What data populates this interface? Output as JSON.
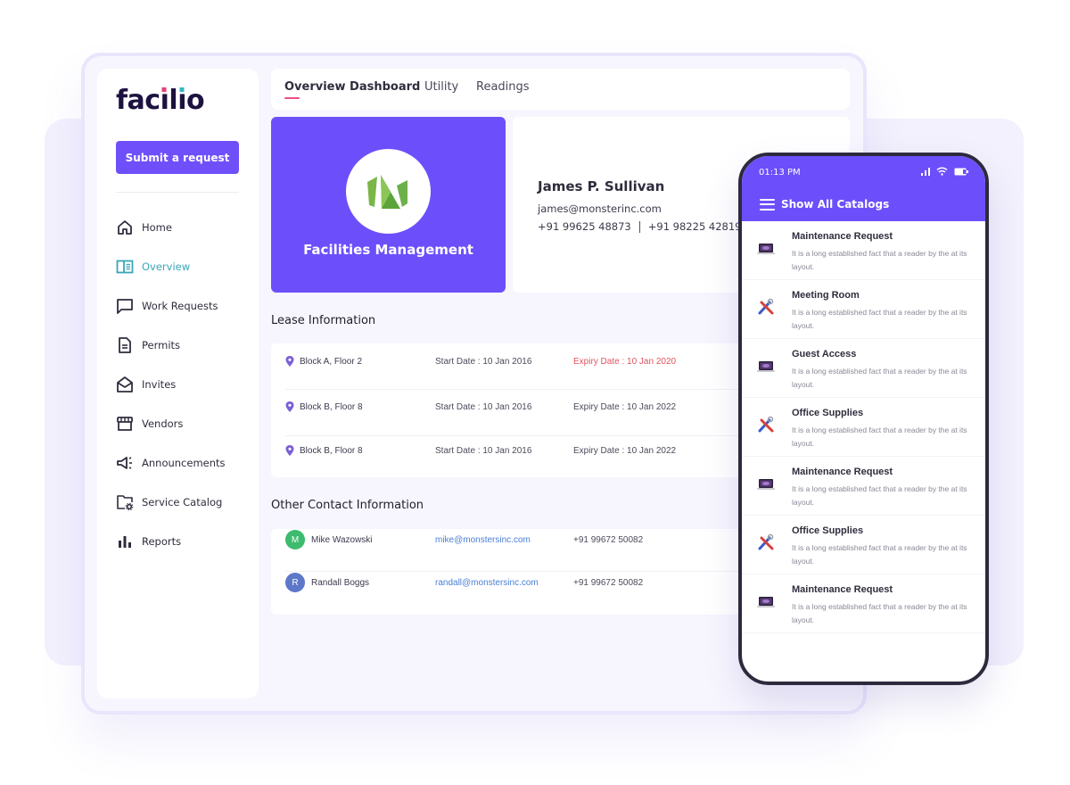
{
  "app": {
    "logo_text": "facilio",
    "submit_button": "Submit a request"
  },
  "sidebar": {
    "items": [
      {
        "label": "Home",
        "icon": "home-icon",
        "active": false
      },
      {
        "label": "Overview",
        "icon": "overview-icon",
        "active": true
      },
      {
        "label": "Work Requests",
        "icon": "chat-icon",
        "active": false
      },
      {
        "label": "Permits",
        "icon": "document-icon",
        "active": false
      },
      {
        "label": "Invites",
        "icon": "envelope-open-icon",
        "active": false
      },
      {
        "label": "Vendors",
        "icon": "store-icon",
        "active": false
      },
      {
        "label": "Announcements",
        "icon": "megaphone-icon",
        "active": false
      },
      {
        "label": "Service Catalog",
        "icon": "folder-settings-icon",
        "active": false
      },
      {
        "label": "Reports",
        "icon": "bar-chart-icon",
        "active": false
      }
    ]
  },
  "tabs": [
    {
      "label": "Overview Dashboard",
      "active": true
    },
    {
      "label": "Utility",
      "active": false
    },
    {
      "label": "Readings",
      "active": false
    }
  ],
  "facility_card": {
    "title": "Facilities Management",
    "background": "#6c4ffb"
  },
  "profile": {
    "name": "James P. Sullivan",
    "email": "james@monsterinc.com",
    "phone_1": "+91 99625 48873",
    "phone_2": "+91 98225 42819"
  },
  "lease": {
    "title": "Lease Information",
    "rows": [
      {
        "location": "Block A, Floor 2",
        "start": "Start Date : 10 Jan 2016",
        "expiry": "Expiry Date : 10 Jan 2020",
        "expired": true
      },
      {
        "location": "Block B, Floor 8",
        "start": "Start Date : 10 Jan 2016",
        "expiry": "Expiry Date : 10 Jan 2022",
        "expired": false
      },
      {
        "location": "Block B, Floor 8",
        "start": "Start Date : 10 Jan 2016",
        "expiry": "Expiry Date : 10 Jan 2022",
        "expired": false
      }
    ]
  },
  "contacts": {
    "title": "Other Contact Information",
    "rows": [
      {
        "initial": "M",
        "name": "Mike Wazowski",
        "email": "mike@monstersinc.com",
        "phone": "+91 99672 50082",
        "avatar_color": "#3dbb6e"
      },
      {
        "initial": "R",
        "name": "Randall Boggs",
        "email": "randall@monstersinc.com",
        "phone": "+91 99672 50082",
        "avatar_color": "#5d77c9"
      }
    ]
  },
  "mobile": {
    "time": "01:13 PM",
    "title": "Show All Catalogs",
    "items": [
      {
        "title": "Maintenance Request",
        "desc": "It is a long established fact that a reader by the at its layout.",
        "icon": "laptop-icon"
      },
      {
        "title": "Meeting Room",
        "desc": "It is a long established fact that a reader by the at its layout.",
        "icon": "tools-icon"
      },
      {
        "title": "Guest Access",
        "desc": "It is a long established fact that a reader by the at its layout.",
        "icon": "laptop-icon"
      },
      {
        "title": "Office Supplies",
        "desc": "It is a long established fact that a reader by the at its layout.",
        "icon": "tools-icon"
      },
      {
        "title": "Maintenance Request",
        "desc": "It is a long established fact that a reader by the at its layout.",
        "icon": "laptop-icon"
      },
      {
        "title": "Office Supplies",
        "desc": "It is a long established fact that a reader by the at its layout.",
        "icon": "tools-icon"
      },
      {
        "title": "Maintenance Request",
        "desc": "It is a long established fact that a reader by the at its layout.",
        "icon": "laptop-icon"
      }
    ]
  },
  "colors": {
    "accent": "#6f4ff9",
    "active_nav": "#3aa6b9",
    "tab_underline": "#ea4f86",
    "expired": "#e0555f",
    "link": "#4a7fd4"
  }
}
